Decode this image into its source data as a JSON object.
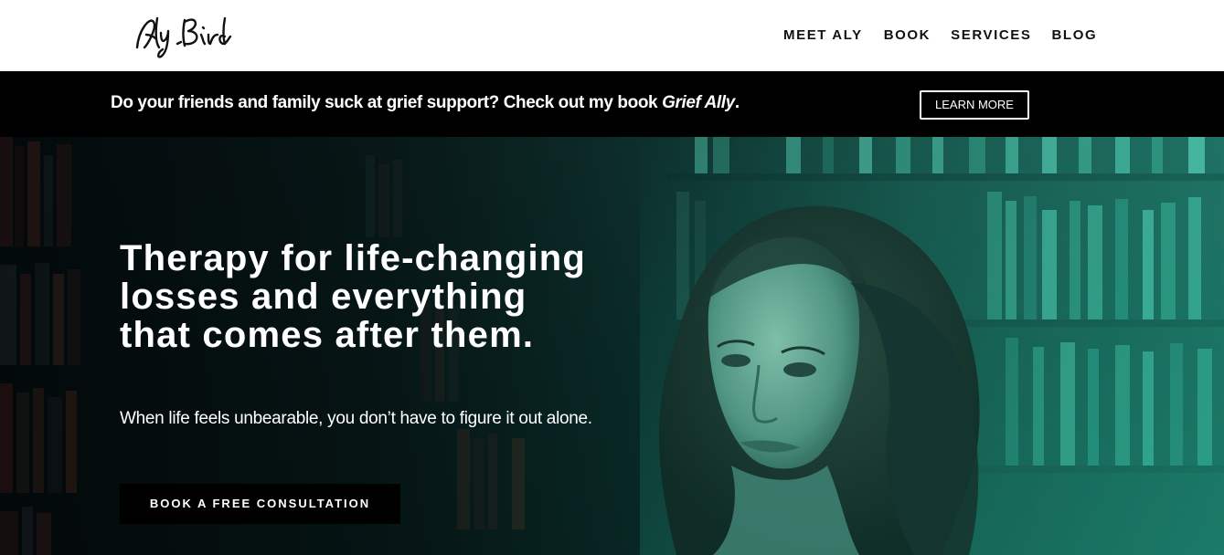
{
  "header": {
    "logo_text": "Aly Bird",
    "nav": [
      {
        "label": "MEET ALY"
      },
      {
        "label": "BOOK"
      },
      {
        "label": "SERVICES"
      },
      {
        "label": "BLOG"
      }
    ]
  },
  "banner": {
    "text_prefix": "Do your friends and family suck at grief support? Check out my book ",
    "book_title": "Grief Ally",
    "text_suffix": ".",
    "button_label": "LEARN MORE"
  },
  "hero": {
    "title": "Therapy for life-changing losses and everything that comes after them.",
    "subtitle": "When life feels unbearable, you don’t have to figure it out alone.",
    "cta_label": "BOOK A FREE CONSULTATION"
  },
  "colors": {
    "banner_bg": "#000000",
    "hero_tint": "#1fa58a",
    "text_primary": "#111111"
  }
}
